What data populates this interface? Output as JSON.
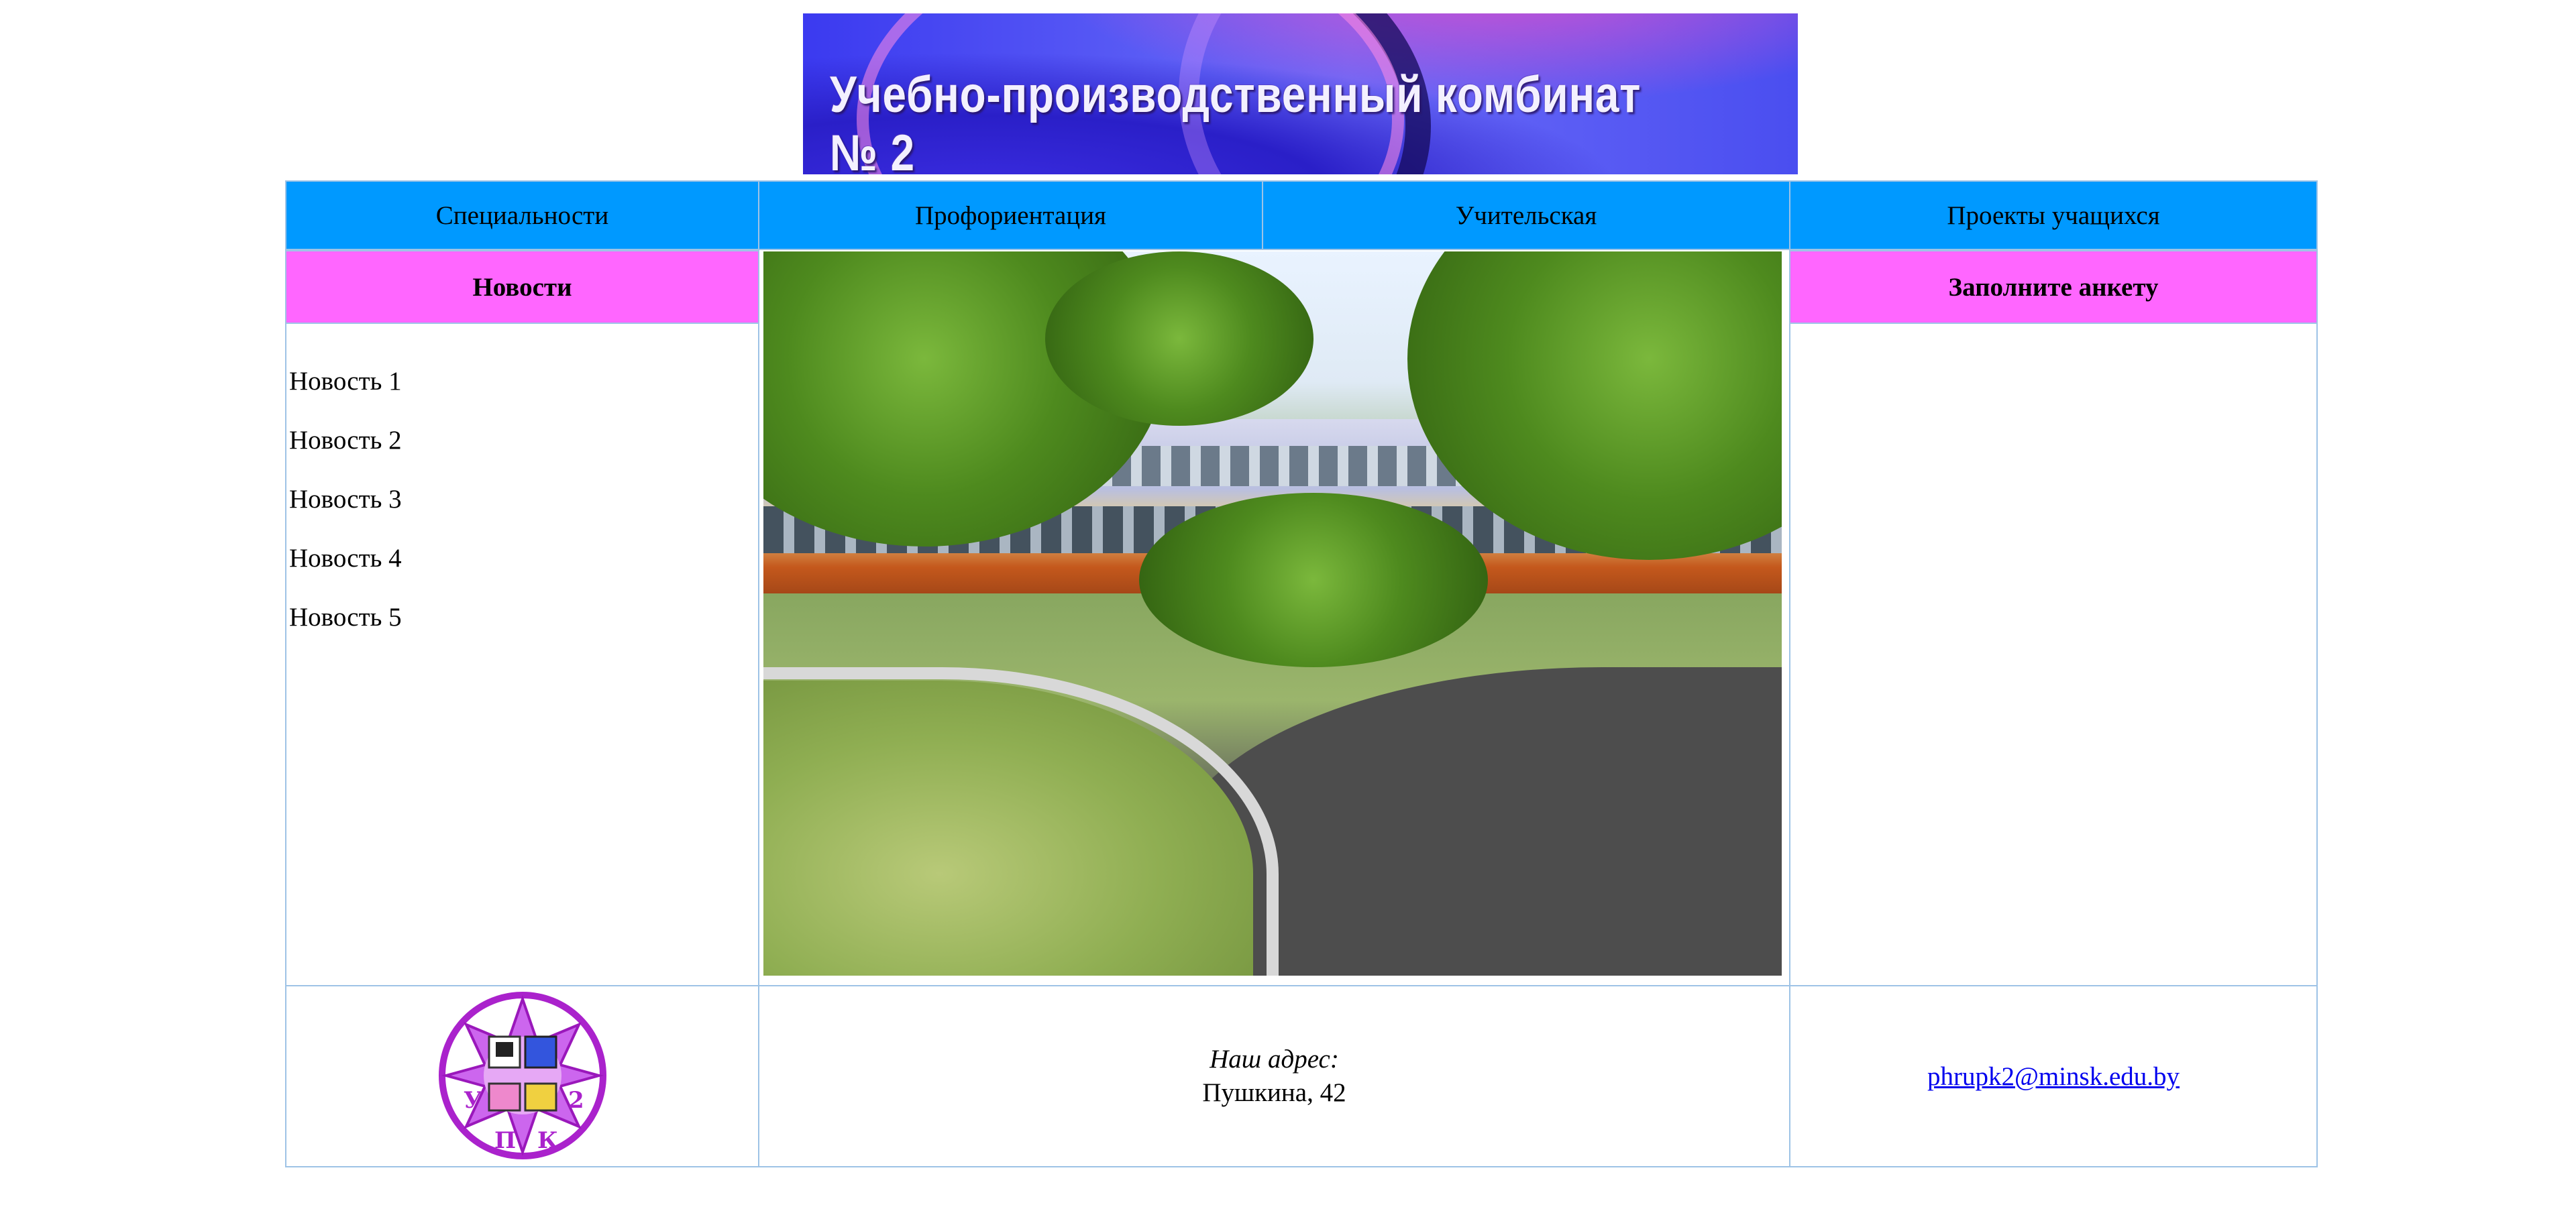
{
  "banner": {
    "title": "Учебно-производственный комбинат № 2"
  },
  "nav": {
    "items": [
      {
        "label": "Специальности"
      },
      {
        "label": "Профориентация"
      },
      {
        "label": "Учительская"
      },
      {
        "label": "Проекты учащихся"
      }
    ]
  },
  "sections": {
    "news_title": "Новости",
    "survey_title": "Заполните анкету"
  },
  "news": {
    "items": [
      "Новость 1",
      "Новость 2",
      "Новость 3",
      "Новость 4",
      "Новость 5"
    ]
  },
  "footer": {
    "address_label": "Наш адрес:",
    "address": "Пушкина, 42",
    "email": "phrupk2@minsk.edu.by",
    "logo_letters": [
      "У",
      "П",
      "К",
      "2"
    ]
  },
  "colors": {
    "nav_bg": "#0099ff",
    "header_bg": "#ff66ff",
    "border": "#9ec3e6",
    "logo": "#aa22cc",
    "link": "#0000ee"
  }
}
